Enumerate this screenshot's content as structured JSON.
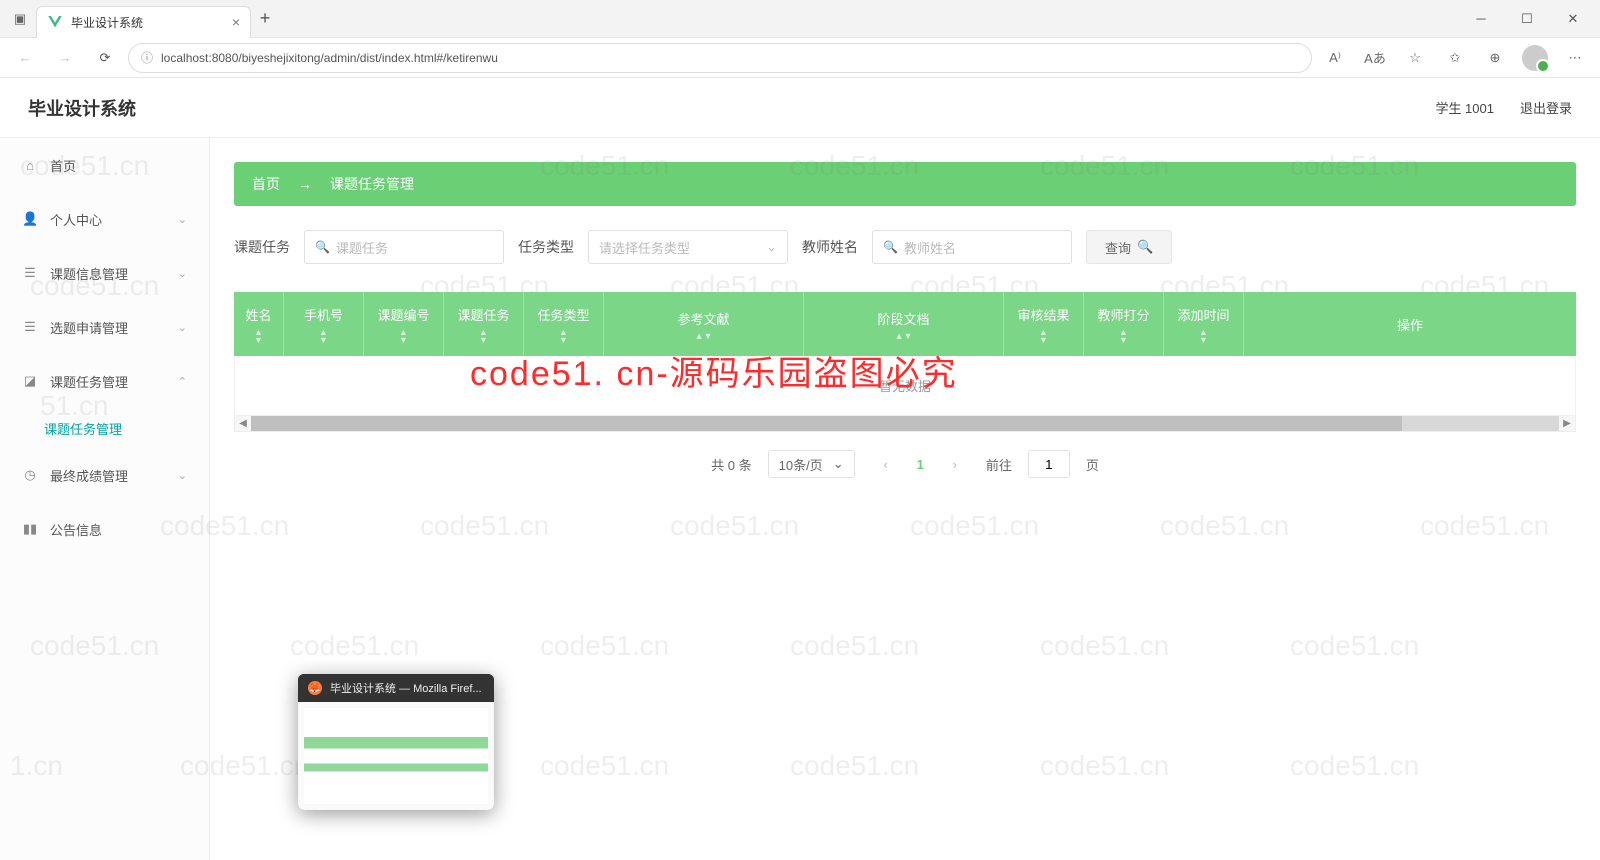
{
  "browser": {
    "tab_title": "毕业设计系统",
    "url": "localhost:8080/biyeshejixitong/admin/dist/index.html#/ketirenwu"
  },
  "header": {
    "app_title": "毕业设计系统",
    "user": "学生 1001",
    "logout": "退出登录"
  },
  "sidebar": {
    "items": [
      {
        "icon": "home",
        "label": "首页"
      },
      {
        "icon": "user",
        "label": "个人中心",
        "chev": true
      },
      {
        "icon": "list",
        "label": "课题信息管理",
        "chev": true
      },
      {
        "icon": "list",
        "label": "选题申请管理",
        "chev": true
      },
      {
        "icon": "task",
        "label": "课题任务管理",
        "chev": true,
        "expanded": true
      },
      {
        "icon": "check",
        "label": "最终成绩管理",
        "chev": true
      },
      {
        "icon": "notice",
        "label": "公告信息"
      }
    ],
    "sub_active": "课题任务管理"
  },
  "crumb": {
    "home": "首页",
    "current": "课题任务管理"
  },
  "filters": {
    "label1": "课题任务",
    "ph1": "课题任务",
    "label2": "任务类型",
    "ph2": "请选择任务类型",
    "label3": "教师姓名",
    "ph3": "教师姓名",
    "query_btn": "查询"
  },
  "table": {
    "columns": [
      "姓名",
      "手机号",
      "课题编号",
      "课题任务",
      "任务类型",
      "参考文献",
      "阶段文档",
      "审核结果",
      "教师打分",
      "添加时间",
      "操作"
    ],
    "empty": "暂无数据"
  },
  "pager": {
    "total_text": "共 0 条",
    "page_size": "10条/页",
    "current": "1",
    "goto_label": "前往",
    "goto_value": "1",
    "page_suffix": "页"
  },
  "watermark_text": "code51. cn-源码乐园盗图必究",
  "taskbar_preview_title": "毕业设计系统 — Mozilla Firef..."
}
